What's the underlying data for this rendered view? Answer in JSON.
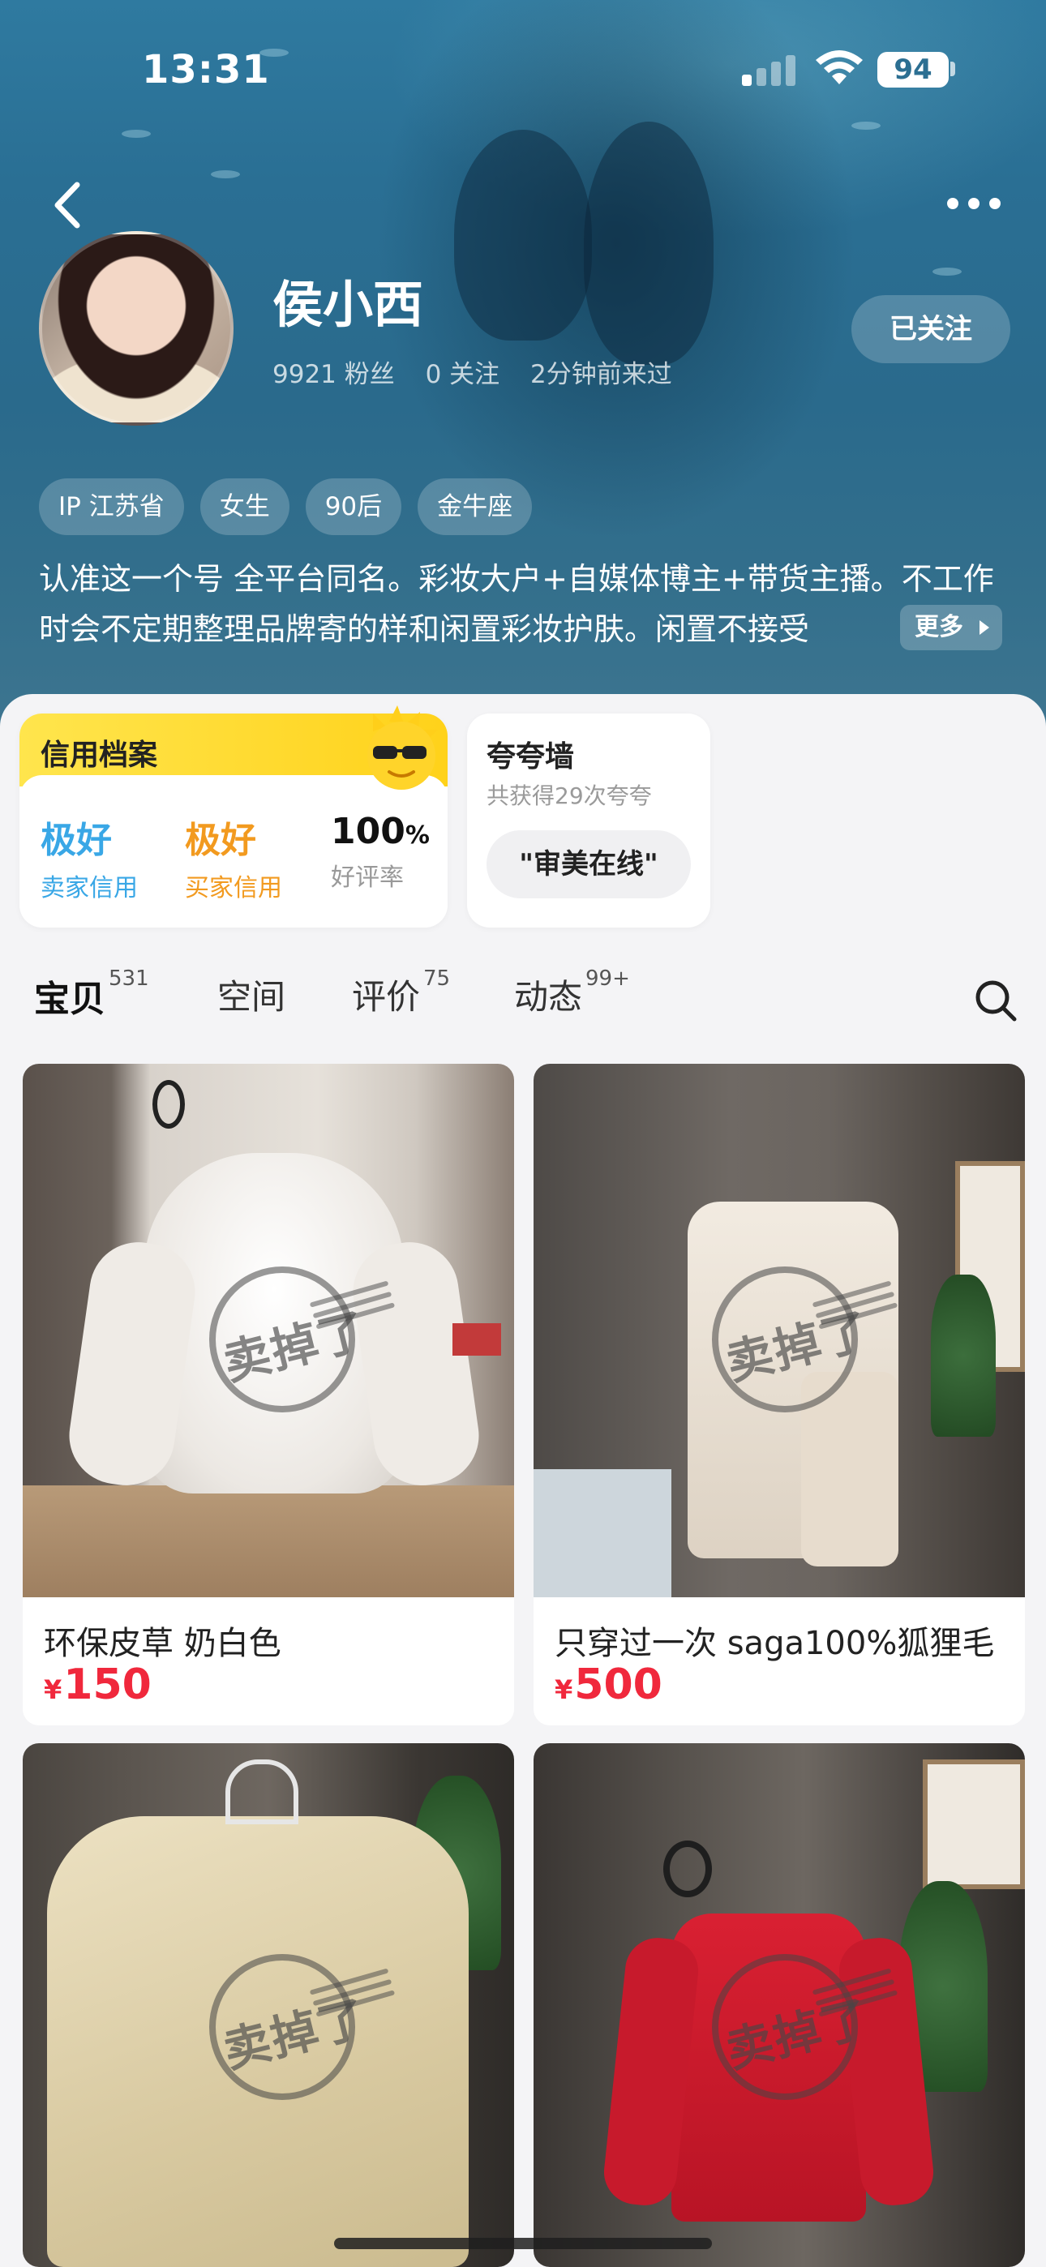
{
  "status_bar": {
    "time": "13:31",
    "battery": "94"
  },
  "profile": {
    "name": "侯小西",
    "fans": "9921 粉丝",
    "following": "0 关注",
    "last_seen": "2分钟前来过",
    "follow_button": "已关注",
    "tags": [
      "IP 江苏省",
      "女生",
      "90后",
      "金牛座"
    ],
    "bio": "认准这一个号 全平台同名。彩妆大户+自媒体博主+带货主播。不工作时会不定期整理品牌寄的样和闲置彩妆护肤。闲置不接受",
    "bio_more": "更多"
  },
  "credit": {
    "title": "信用档案",
    "seller_value": "极好",
    "seller_label": "卖家信用",
    "buyer_value": "极好",
    "buyer_label": "买家信用",
    "rating_value": "100",
    "rating_unit": "%",
    "rating_label": "好评率",
    "colors": {
      "seller": "#39a7e6",
      "buyer": "#f29a1f"
    }
  },
  "praise": {
    "title": "夸夸墙",
    "subtitle": "共获得29次夸夸",
    "pill": "\"审美在线\""
  },
  "tabs": [
    {
      "label": "宝贝",
      "count": "531",
      "active": true
    },
    {
      "label": "空间",
      "count": "",
      "active": false
    },
    {
      "label": "评价",
      "count": "75",
      "active": false
    },
    {
      "label": "动态",
      "count": "99+",
      "active": false
    }
  ],
  "stamp": {
    "text": "卖掉了"
  },
  "products": [
    {
      "title": "环保皮草 奶白色",
      "currency": "¥",
      "price": "150"
    },
    {
      "title": "只穿过一次 saga100%狐狸毛",
      "currency": "¥",
      "price": "500"
    },
    {
      "title": "",
      "currency": "",
      "price": ""
    },
    {
      "title": "",
      "currency": "",
      "price": ""
    }
  ],
  "icons": [
    "back-icon",
    "more-icon",
    "search-icon",
    "signal-icon",
    "wifi-icon",
    "battery-icon",
    "chevron-right-icon",
    "sun-mascot-icon"
  ]
}
